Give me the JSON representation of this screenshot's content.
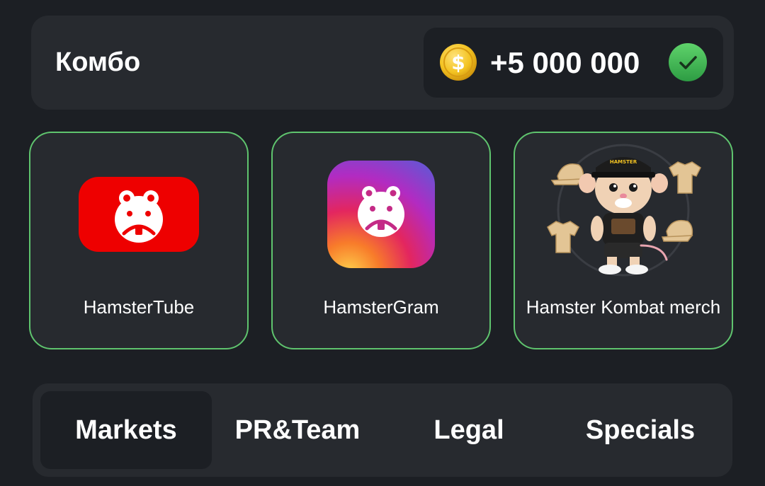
{
  "combo": {
    "title": "Комбо",
    "reward_amount": "+5 000 000",
    "reward_icon": "coin-icon",
    "completed_icon": "checkmark-icon",
    "completed_color": "#3cb257"
  },
  "cards": [
    {
      "label": "HamsterTube",
      "icon": "hamstertube-icon",
      "completed": true
    },
    {
      "label": "HamsterGram",
      "icon": "hamstergram-icon",
      "completed": true
    },
    {
      "label": "Hamster Kombat merch",
      "icon": "hamster-merch-image",
      "completed": true
    }
  ],
  "tabs": [
    {
      "label": "Markets",
      "active": true
    },
    {
      "label": "PR&Team",
      "active": false
    },
    {
      "label": "Legal",
      "active": false
    },
    {
      "label": "Specials",
      "active": false
    }
  ],
  "colors": {
    "background": "#1c1f24",
    "panel": "#272a2f",
    "completed_border": "#5fc46e",
    "coin": "#f3c322"
  }
}
